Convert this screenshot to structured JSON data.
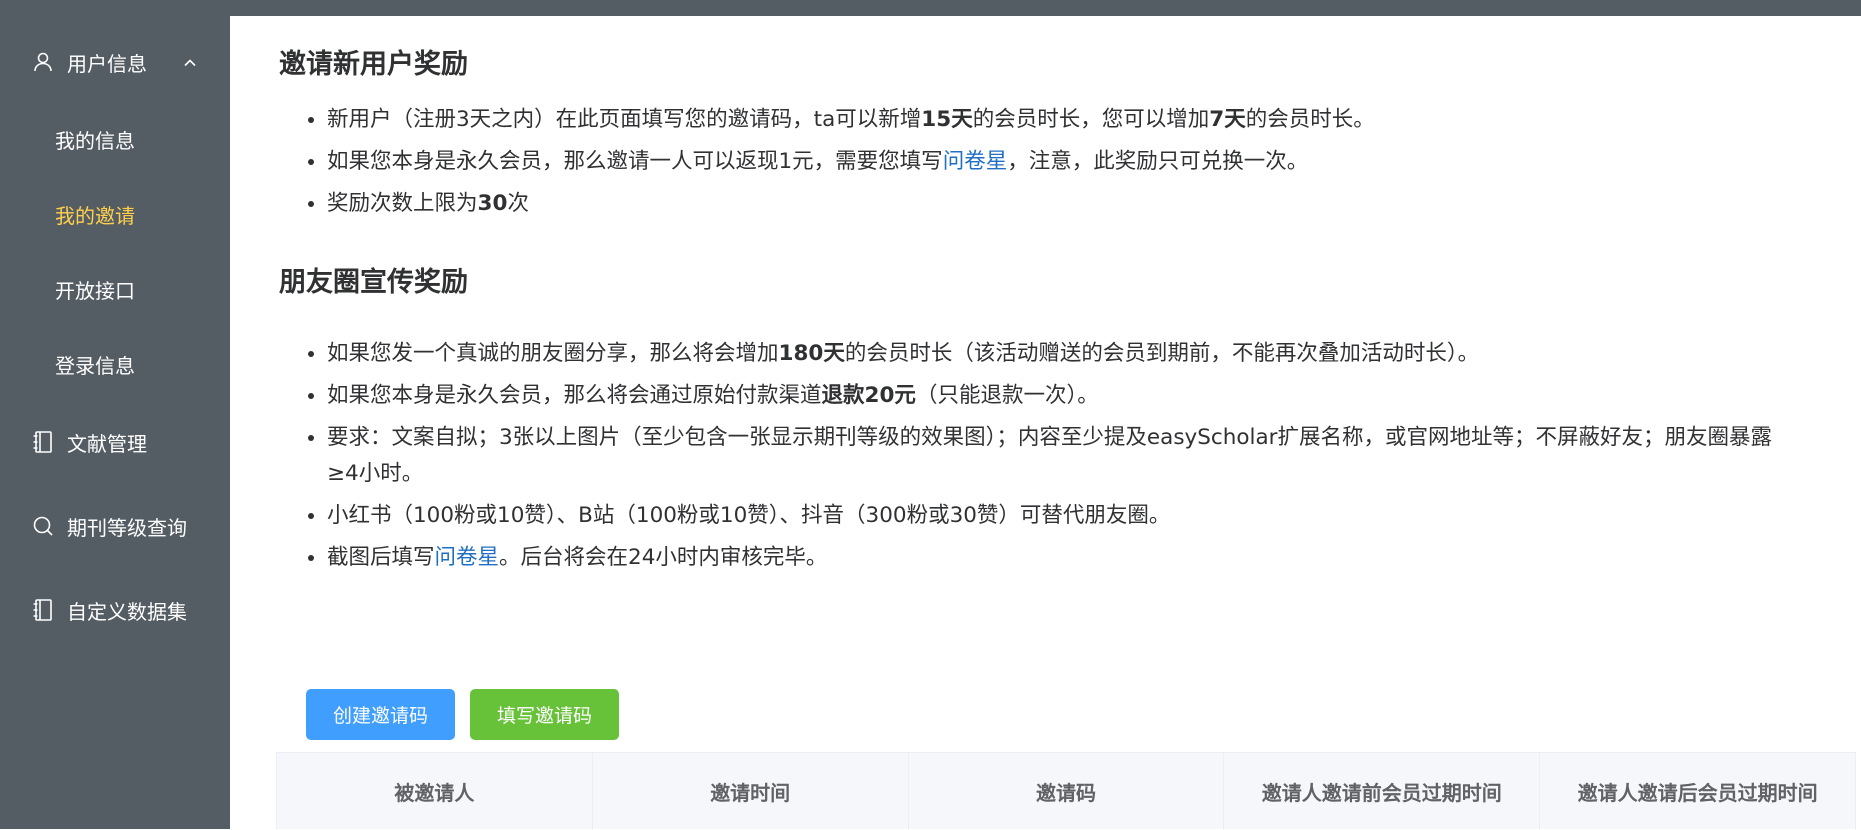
{
  "sidebar": {
    "user_info": {
      "label": "用户信息",
      "icon": "user-icon",
      "expanded_icon": "chevron-up-icon"
    },
    "submenu": [
      {
        "label": "我的信息"
      },
      {
        "label": "我的邀请",
        "active": true
      },
      {
        "label": "开放接口"
      },
      {
        "label": "登录信息"
      }
    ],
    "items": [
      {
        "label": "文献管理",
        "icon": "notebook-icon"
      },
      {
        "label": "期刊等级查询",
        "icon": "search-icon"
      },
      {
        "label": "自定义数据集",
        "icon": "notebook-icon"
      }
    ],
    "bg_color": "#545c64",
    "active_color": "#ffd04b"
  },
  "invite_section": {
    "title": "邀请新用户奖励",
    "rule1": {
      "part1": "新用户（注册3天之内）在此页面填写您的邀请码，ta可以新增",
      "bold1": "15天",
      "part2": "的会员时长，您可以增加",
      "bold2": "7天",
      "part3": "的会员时长。"
    },
    "rule2": {
      "part1": "如果您本身是永久会员，那么邀请一人可以返现1元，需要您填写",
      "link": "问卷星",
      "part2": "，注意，此奖励只可兑换一次。"
    },
    "rule3": {
      "part1": "奖励次数上限为",
      "bold": "30",
      "part2": "次"
    }
  },
  "moments_section": {
    "title": "朋友圈宣传奖励",
    "rule1": {
      "part1": "如果您发一个真诚的朋友圈分享，那么将会增加",
      "bold": "180天",
      "part2": "的会员时长（该活动赠送的会员到期前，不能再次叠加活动时长）。"
    },
    "rule2": {
      "part1": "如果您本身是永久会员，那么将会通过原始付款渠道",
      "bold": "退款20元",
      "part2": "（只能退款一次）。"
    },
    "rule3": "要求：文案自拟；3张以上图片（至少包含一张显示期刊等级的效果图）；内容至少提及easyScholar扩展名称，或官网地址等；不屏蔽好友；朋友圈暴露≥4小时。",
    "rule4": "小红书（100粉或10赞）、B站（100粉或10赞）、抖音（300粉或30赞）可替代朋友圈。",
    "rule5": {
      "part1": "截图后填写",
      "link": "问卷星",
      "part2": "。后台将会在24小时内审核完毕。"
    }
  },
  "buttons": {
    "create": "创建邀请码",
    "fill": "填写邀请码"
  },
  "table": {
    "columns": [
      "被邀请人",
      "邀请时间",
      "邀请码",
      "邀请人邀请前会员过期时间",
      "邀请人邀请后会员过期时间"
    ]
  },
  "colors": {
    "link": "#1f6fc4",
    "primary": "#409eff",
    "success": "#67c23a"
  }
}
